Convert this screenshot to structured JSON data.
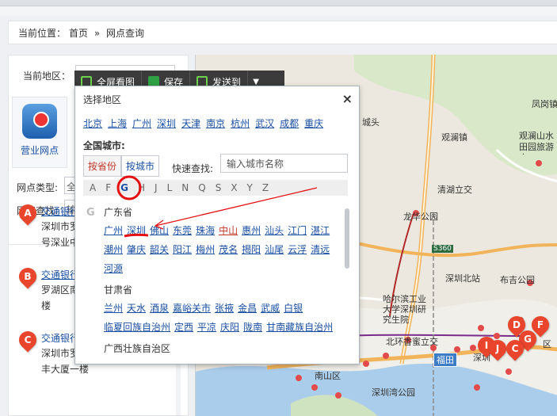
{
  "breadcrumb": {
    "label": "当前位置：",
    "home": "首页",
    "sep": "»",
    "current": "网点查询"
  },
  "left": {
    "region_label": "当前地区：",
    "tab_label": "营业网点",
    "type_label": "网点类型:",
    "type_value": "全",
    "search_label": "网点查找:",
    "search_value": "输"
  },
  "results": [
    {
      "letter": "A",
      "title": "交通银行",
      "addr1": "深圳市罗",
      "addr2": "号深业中"
    },
    {
      "letter": "B",
      "title": "交通银行",
      "addr1": "罗湖区南",
      "addr2": "楼"
    },
    {
      "letter": "C",
      "title": "交通银行深圳罗湖支行",
      "addr1": "深圳市罗湖区宝安南路湖北宝",
      "addr2": "丰大厦一楼"
    }
  ],
  "toolbar": {
    "fullscreen": "全屏看图",
    "save": "保存",
    "send": "发送到",
    "caret": "▼"
  },
  "city_panel": {
    "title": "选择地区",
    "close": "×",
    "hot_cities": [
      "北京",
      "上海",
      "广州",
      "深圳",
      "天津",
      "南京",
      "杭州",
      "武汉",
      "成都",
      "重庆"
    ],
    "national_label": "全国城市:",
    "tabs": [
      "按省份",
      "按城市"
    ],
    "quick_label": "快速查找:",
    "quick_placeholder": "输入城市名称",
    "letters": [
      "A",
      "F",
      "G",
      "H",
      "J",
      "L",
      "N",
      "Q",
      "S",
      "X",
      "Y",
      "Z"
    ],
    "selected_letter": "G",
    "group_letter": "G",
    "provinces": [
      {
        "name": "广东省",
        "cities": [
          "广州",
          "深圳",
          "佛山",
          "东莞",
          "珠海",
          "中山",
          "惠州",
          "汕头",
          "江门",
          "湛江",
          "潮州",
          "肇庆",
          "韶关",
          "阳江",
          "梅州",
          "茂名",
          "揭阳",
          "汕尾",
          "云浮",
          "清远",
          "河源"
        ],
        "highlight": "中山"
      },
      {
        "name": "甘肃省",
        "cities": [
          "兰州",
          "天水",
          "酒泉",
          "嘉峪关市",
          "张掖",
          "金昌",
          "武威",
          "白银",
          "临夏回族自治州",
          "定西",
          "平凉",
          "庆阳",
          "陇南",
          "甘南藏族自治州"
        ]
      },
      {
        "name": "广西壮族自治区",
        "cities": []
      }
    ]
  },
  "map": {
    "labels": [
      "凤岗镇",
      "城头",
      "观澜镇",
      "观澜山水田园旅游文",
      "清湖立交",
      "龙华公园",
      "深圳北站",
      "布吉公园",
      "哈尔滨工业大学深圳研究生院",
      "北环香蜜立交",
      "深圳",
      "南山区",
      "深圳湾公园",
      "福田区",
      "区"
    ],
    "road_shield": "S360",
    "station_label": "福田",
    "markers": [
      "D",
      "F",
      "G",
      "I",
      "J",
      "C"
    ]
  }
}
